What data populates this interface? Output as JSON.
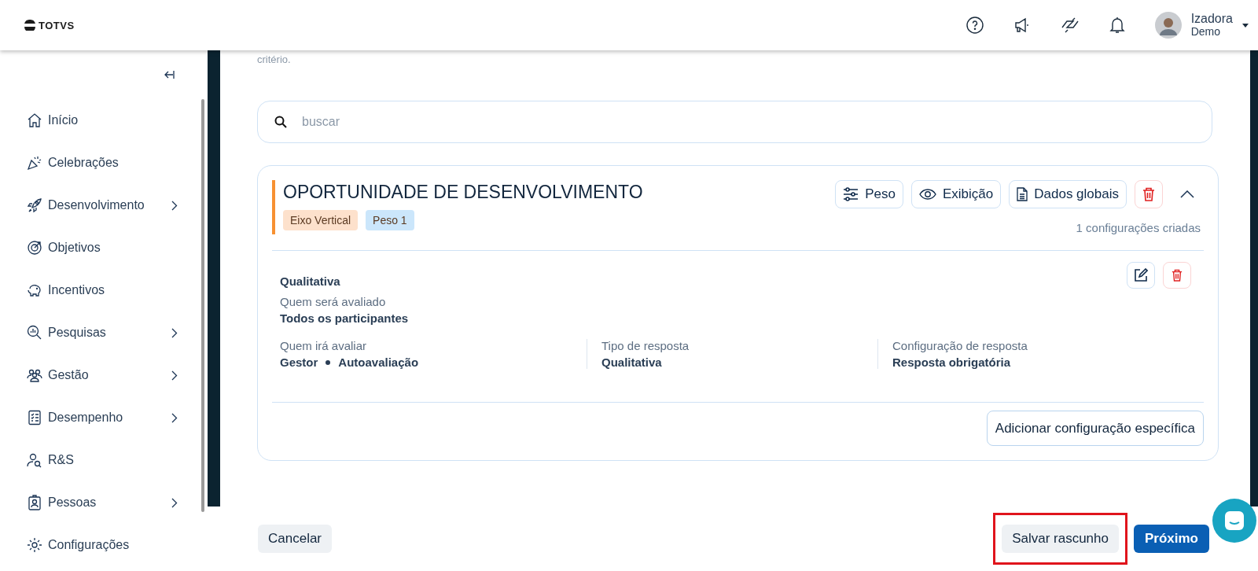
{
  "header": {
    "logo": "TOTVS",
    "user": {
      "name": "Izadora",
      "role": "Demo"
    }
  },
  "sidebar": {
    "items": [
      {
        "label": "Início",
        "expandable": false
      },
      {
        "label": "Celebrações",
        "expandable": false
      },
      {
        "label": "Desenvolvimento",
        "expandable": true
      },
      {
        "label": "Objetivos",
        "expandable": false
      },
      {
        "label": "Incentivos",
        "expandable": false
      },
      {
        "label": "Pesquisas",
        "expandable": true
      },
      {
        "label": "Gestão",
        "expandable": true
      },
      {
        "label": "Desempenho",
        "expandable": true
      },
      {
        "label": "R&S",
        "expandable": false
      },
      {
        "label": "Pessoas",
        "expandable": true
      },
      {
        "label": "Configurações",
        "expandable": false
      }
    ]
  },
  "content": {
    "intro_text": "critério.",
    "search": {
      "placeholder": "buscar"
    },
    "criterion": {
      "title": "OPORTUNIDADE DE DESENVOLVIMENTO",
      "expanded": true,
      "tags": [
        {
          "label": "Eixo Vertical",
          "color": "#fde1cc"
        },
        {
          "label": "Peso 1",
          "color": "#cbe6fb"
        }
      ],
      "actions": [
        {
          "label": "Peso",
          "kind": "sliders"
        },
        {
          "label": "Exibição",
          "kind": "eye"
        },
        {
          "label": "Dados globais",
          "kind": "document"
        }
      ],
      "count": "1 configurações criadas",
      "configuration": {
        "name": "Qualitativa",
        "evaluated_label": "Quem será avaliado",
        "evaluated_value": "Todos os participantes",
        "columns": [
          {
            "label": "Quem irá avaliar",
            "values": [
              "Gestor",
              "Autoavaliação"
            ]
          },
          {
            "label": "Tipo de resposta",
            "values": [
              "Qualitativa"
            ]
          },
          {
            "label": "Configuração de resposta",
            "values": [
              "Resposta obrigatória"
            ]
          }
        ]
      },
      "add_button": "Adicionar configuração específica"
    }
  },
  "footer": {
    "cancel": "Cancelar",
    "save_draft": "Salvar rascunho",
    "save_draft_highlighted": true,
    "next": "Próximo"
  }
}
